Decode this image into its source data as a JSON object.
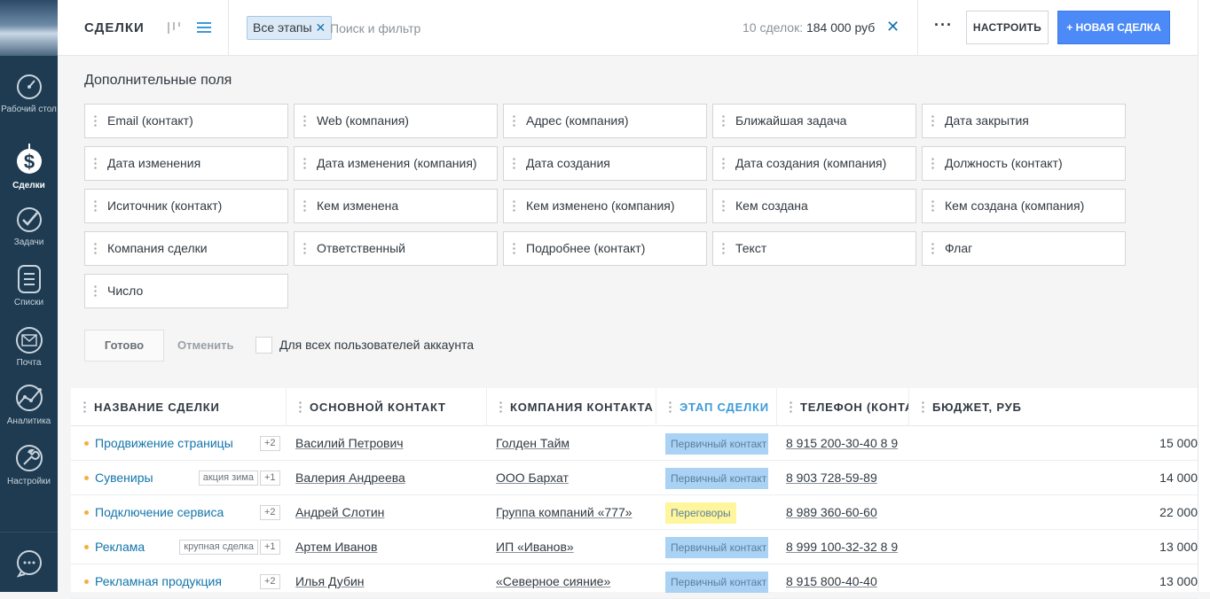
{
  "sidebar": {
    "items": [
      {
        "label": "Рабочий стол",
        "icon": "dashboard-icon"
      },
      {
        "label": "Сделки",
        "icon": "dollar-icon",
        "active": true
      },
      {
        "label": "Задачи",
        "icon": "tasks-check-icon"
      },
      {
        "label": "Списки",
        "icon": "lists-icon"
      },
      {
        "label": "Почта",
        "icon": "mail-icon"
      },
      {
        "label": "Аналитика",
        "icon": "analytics-icon"
      },
      {
        "label": "Настройки",
        "icon": "settings-wrench-icon"
      }
    ],
    "chat_icon": "chat-icon"
  },
  "header": {
    "title": "СДЕЛКИ",
    "filter_chip": "Все этапы",
    "search_placeholder": "Поиск и фильтр",
    "summary_prefix": "10 сделок:",
    "summary_value": "184 000 руб",
    "more": "···",
    "setup_button": "НАСТРОИТЬ",
    "new_deal_button": "+ НОВАЯ СДЕЛКА"
  },
  "fields_panel": {
    "title": "Дополнительные поля",
    "fields": [
      "Email (контакт)",
      "Web (компания)",
      "Адрес (компания)",
      "Ближайшая задача",
      "Дата закрытия",
      "Дата изменения",
      "Дата изменения (компания)",
      "Дата создания",
      "Дата создания (компания)",
      "Должность (контакт)",
      "Иситочник (контакт)",
      "Кем изменена",
      "Кем изменено (компания)",
      "Кем создана",
      "Кем создана (компания)",
      "Компания сделки",
      "Ответственный",
      "Подробнее (контакт)",
      "Текст",
      "Флаг",
      "Число"
    ],
    "done_button": "Готово",
    "cancel_button": "Отменить",
    "all_users_label": "Для всех пользователей аккаунта"
  },
  "table": {
    "columns": [
      "НАЗВАНИЕ СДЕЛКИ",
      "ОСНОВНОЙ КОНТАКТ",
      "КОМПАНИЯ КОНТАКТА",
      "ЭТАП СДЕЛКИ",
      "ТЕЛЕФОН (КОНТАКТ)",
      "БЮДЖЕТ, РУБ"
    ],
    "rows": [
      {
        "name": "Продвижение страницы",
        "tag": "",
        "extra": "+2",
        "contact": "Василий Петрович",
        "company": "Голден Тайм",
        "stage": "Первичный контакт",
        "stage_color": "#a9d2f5",
        "phone": "8 915 200-30-40 8 9",
        "budget": "15 000"
      },
      {
        "name": "Сувениры",
        "tag": "акция зима",
        "extra": "+1",
        "contact": "Валерия Андреева",
        "company": "ООО Бархат",
        "stage": "Первичный контакт",
        "stage_color": "#a9d2f5",
        "phone": "8 903 728-59-89",
        "budget": "14 000"
      },
      {
        "name": "Подключение сервиса",
        "tag": "",
        "extra": "+2",
        "contact": "Андрей Слотин",
        "company": "Группа компаний «777»",
        "stage": "Переговоры",
        "stage_color": "#fff59d",
        "phone": "8 989 360-60-60",
        "budget": "22 000"
      },
      {
        "name": "Реклама",
        "tag": "крупная сделка",
        "extra": "+1",
        "contact": "Артем Иванов",
        "company": "ИП «Иванов»",
        "stage": "Первичный контакт",
        "stage_color": "#a9d2f5",
        "phone": "8 999 100-32-32 8 9",
        "budget": "13 000"
      },
      {
        "name": "Рекламная продукция",
        "tag": "",
        "extra": "+2",
        "contact": "Илья Дубин",
        "company": "«Северное сияние»",
        "stage": "Первичный контакт",
        "stage_color": "#a9d2f5",
        "phone": "8 915 800-40-40",
        "budget": "13 000"
      }
    ]
  },
  "colors": {
    "sidebar_bg": "#1e3b51",
    "accent_blue": "#4c8bf7",
    "link_blue": "#1375ab",
    "stage_header": "#3b9ad9"
  }
}
